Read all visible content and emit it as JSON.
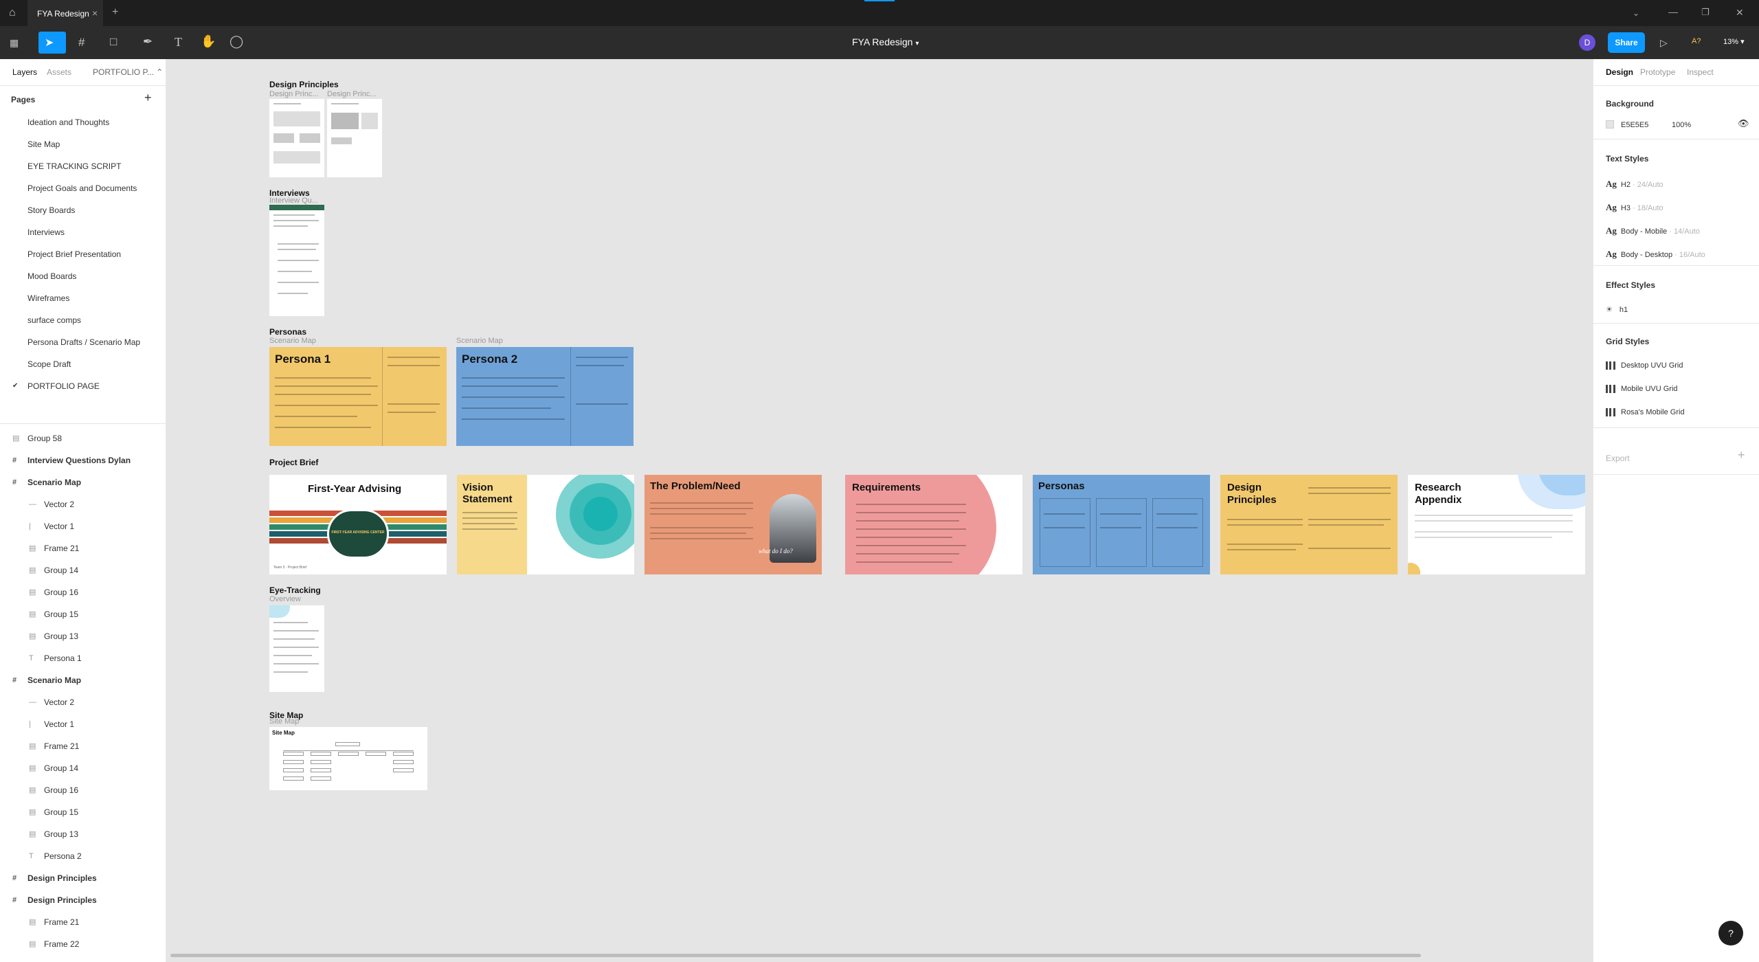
{
  "tabbar": {
    "file_tab": "FYA Redesign",
    "add_tab": "+",
    "close": "×"
  },
  "toolbar": {
    "file_name": "FYA Redesign",
    "avatar_letter": "D",
    "share_label": "Share",
    "a_label": "A?",
    "zoom": "13%"
  },
  "left_panel": {
    "tabs": [
      "Layers",
      "Assets",
      "PORTFOLIO P..."
    ],
    "pages_label": "Pages",
    "pages": [
      "Ideation and Thoughts",
      "Site Map",
      "EYE TRACKING SCRIPT",
      "Project Goals and Documents",
      "Story Boards",
      "Interviews",
      "Project Brief Presentation",
      "Mood Boards",
      "Wireframes",
      "surface comps",
      "Persona Drafts / Scenario Map",
      "Scope Draft",
      "PORTFOLIO PAGE"
    ],
    "current_page": "PORTFOLIO PAGE",
    "layers": [
      {
        "name": "Group 58",
        "indent": 0,
        "icon": "group"
      },
      {
        "name": "Interview Questions Dylan",
        "indent": 0,
        "icon": "frame"
      },
      {
        "name": "Scenario Map",
        "indent": 0,
        "icon": "frame"
      },
      {
        "name": "Vector 2",
        "indent": 1,
        "icon": "line"
      },
      {
        "name": "Vector 1",
        "indent": 1,
        "icon": "vline"
      },
      {
        "name": "Frame 21",
        "indent": 1,
        "icon": "group"
      },
      {
        "name": "Group 14",
        "indent": 1,
        "icon": "group"
      },
      {
        "name": "Group 16",
        "indent": 1,
        "icon": "group"
      },
      {
        "name": "Group 15",
        "indent": 1,
        "icon": "group"
      },
      {
        "name": "Group 13",
        "indent": 1,
        "icon": "group"
      },
      {
        "name": "Persona 1",
        "indent": 1,
        "icon": "text"
      },
      {
        "name": "Scenario Map",
        "indent": 0,
        "icon": "frame"
      },
      {
        "name": "Vector 2",
        "indent": 1,
        "icon": "line"
      },
      {
        "name": "Vector 1",
        "indent": 1,
        "icon": "vline"
      },
      {
        "name": "Frame 21",
        "indent": 1,
        "icon": "group"
      },
      {
        "name": "Group 14",
        "indent": 1,
        "icon": "group"
      },
      {
        "name": "Group 16",
        "indent": 1,
        "icon": "group"
      },
      {
        "name": "Group 15",
        "indent": 1,
        "icon": "group"
      },
      {
        "name": "Group 13",
        "indent": 1,
        "icon": "group"
      },
      {
        "name": "Persona 2",
        "indent": 1,
        "icon": "text"
      },
      {
        "name": "Design Principles",
        "indent": 0,
        "icon": "frame"
      },
      {
        "name": "Design Principles",
        "indent": 0,
        "icon": "frame"
      },
      {
        "name": "Frame 21",
        "indent": 1,
        "icon": "group"
      },
      {
        "name": "Frame 22",
        "indent": 1,
        "icon": "group"
      }
    ]
  },
  "canvas": {
    "sections": {
      "design_principles": {
        "label": "Design Principles",
        "sub1": "Design Princ...",
        "sub2": "Design Princ..."
      },
      "interviews": {
        "label": "Interviews",
        "sub": "Interview Qu..."
      },
      "personas": {
        "label": "Personas",
        "sub1": "Scenario Map",
        "sub2": "Scenario Map",
        "p1": "Persona 1",
        "p2": "Persona 2"
      },
      "project_brief": {
        "label": "Project Brief"
      },
      "eye_tracking": {
        "label": "Eye-Tracking",
        "sub": "Overview"
      },
      "site_map": {
        "label": "Site Map",
        "sub": "Site Map",
        "inner": "Site Map"
      }
    },
    "slides": [
      "First-Year Advising",
      "Vision Statement",
      "The Problem/Need",
      "Requirements",
      "Personas",
      "Design Principles",
      "Research Appendix"
    ],
    "badge_text": "FIRST-YEAR ADVISING CENTER",
    "slide_footer_left": "Team 3 · Project Brief",
    "problem_caption": "what do I do?"
  },
  "right_panel": {
    "tabs": [
      "Design",
      "Prototype",
      "Inspect"
    ],
    "background_label": "Background",
    "bg_hex": "E5E5E5",
    "bg_opacity": "100%",
    "text_styles_label": "Text Styles",
    "text_styles": [
      {
        "name": "H2",
        "meta": "24/Auto"
      },
      {
        "name": "H3",
        "meta": "18/Auto"
      },
      {
        "name": "Body - Mobile",
        "meta": "14/Auto"
      },
      {
        "name": "Body - Desktop",
        "meta": "16/Auto"
      }
    ],
    "effect_styles_label": "Effect Styles",
    "effect": "h1",
    "grid_styles_label": "Grid Styles",
    "grids": [
      "Desktop UVU Grid",
      "Mobile UVU Grid",
      "Rosa's Mobile Grid"
    ],
    "export_label": "Export",
    "help": "?"
  },
  "colors": {
    "accent": "#0d99ff",
    "yellow": "#f2c86c",
    "blue": "#6fa3d8",
    "orange": "#e89a78",
    "pink": "#ef9a9a",
    "teal": "#1bb3b1"
  }
}
